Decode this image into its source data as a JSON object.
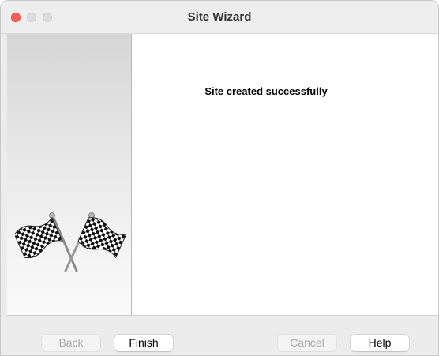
{
  "window": {
    "title": "Site Wizard"
  },
  "content": {
    "message": "Site created successfully"
  },
  "buttons": {
    "back": "Back",
    "finish": "Finish",
    "cancel": "Cancel",
    "help": "Help"
  },
  "icons": {
    "side_image": "checkered-flags-icon"
  },
  "colors": {
    "close_button": "#fe5f57",
    "content_background": "#ffffff",
    "window_background": "#ececec"
  }
}
